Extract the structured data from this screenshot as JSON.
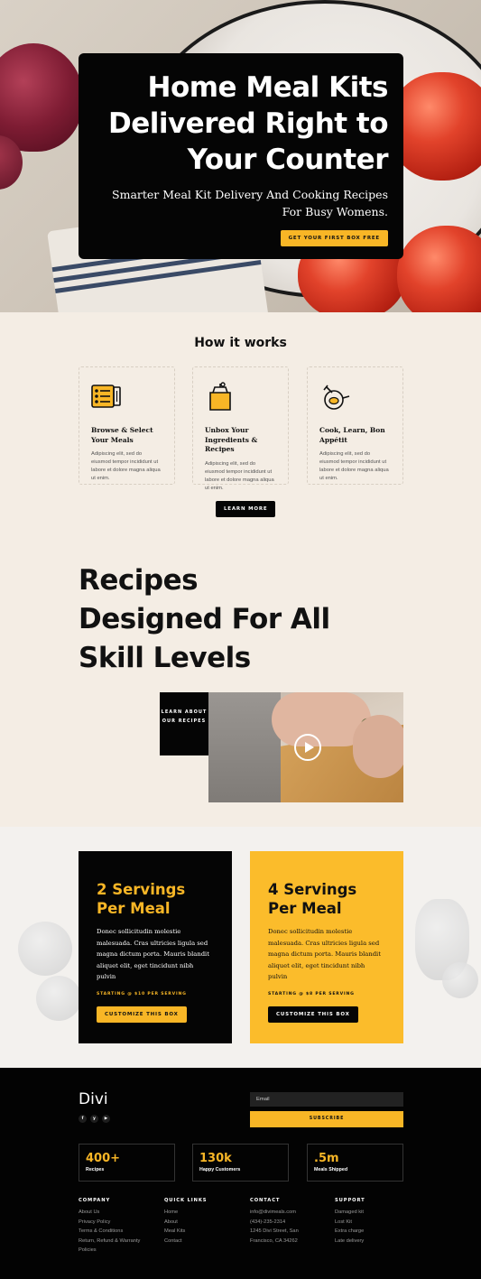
{
  "hero": {
    "title": "Home Meal Kits Delivered Right to Your Counter",
    "subtitle": "Smarter Meal Kit Delivery And Cooking Recipes For Busy Womens.",
    "cta": "GET YOUR FIRST BOX FREE"
  },
  "how": {
    "title": "How it works",
    "steps": [
      {
        "icon": "menu-list-icon",
        "title": "Browse & Select Your Meals",
        "text": "Adipiscing elit, sed do eiusmod tempor incididunt ut labore et dolore magna aliqua ut enim."
      },
      {
        "icon": "grocery-bag-icon",
        "title": "Unbox Your Ingredients & Recipes",
        "text": "Adipiscing elit, sed do eiusmod tempor incididunt ut labore et dolore magna aliqua ut enim."
      },
      {
        "icon": "cooking-pan-icon",
        "title": "Cook, Learn, Bon Appétit",
        "text": "Adipiscing elit, sed do eiusmod tempor incididunt ut labore et dolore magna aliqua ut enim."
      }
    ],
    "button": "LEARN MORE"
  },
  "recipes": {
    "title": "Recipes Designed For All Skill Levels",
    "learn_label": "LEARN ABOUT OUR RECIPES"
  },
  "servings": [
    {
      "title": "2 Servings Per Meal",
      "text": "Donec sollicitudin molestie malesuada. Cras ultricies ligula sed magna dictum porta. Mauris blandit aliquet elit, eget tincidunt nibh pulvin",
      "price": "STARTING @ $10 PER SERVING",
      "button": "CUSTOMIZE THIS BOX"
    },
    {
      "title": "4 Servings Per Meal",
      "text": "Donec sollicitudin molestie malesuada. Cras ultricies ligula sed magna dictum porta. Mauris blandit aliquet elit, eget tincidunt nibh pulvin",
      "price": "STARTING @ $8 PER SERVING",
      "button": "CUSTOMIZE THIS BOX"
    }
  ],
  "footer": {
    "logo": "Divi",
    "socials": [
      "f",
      "y",
      "▶"
    ],
    "email_placeholder": "Email",
    "subscribe": "SUBSCRIBE",
    "stats": [
      {
        "value": "400+",
        "label": "Recipes"
      },
      {
        "value": "130k",
        "label": "Happy Customers"
      },
      {
        "value": ".5m",
        "label": "Meals Shipped"
      }
    ],
    "columns": [
      {
        "title": "COMPANY",
        "links": [
          "About Us",
          "Privacy Policy",
          "Terms & Conditions",
          "Return, Refund & Warranty",
          "Policies"
        ]
      },
      {
        "title": "QUICK LINKS",
        "links": [
          "Home",
          "About",
          "Meal Kits",
          "Contact"
        ]
      },
      {
        "title": "CONTACT",
        "links": [
          "info@divimeals.com",
          "(434)-235-2314",
          "1245 Divi Street, San",
          "Francisco, CA 34262"
        ]
      },
      {
        "title": "SUPPORT",
        "links": [
          "Damaged kit",
          "Lost Kit",
          "Extra charge",
          "Late delivery"
        ]
      }
    ]
  },
  "colors": {
    "accent": "#f8b626",
    "dark": "#050505",
    "background": "#f4ede4"
  }
}
